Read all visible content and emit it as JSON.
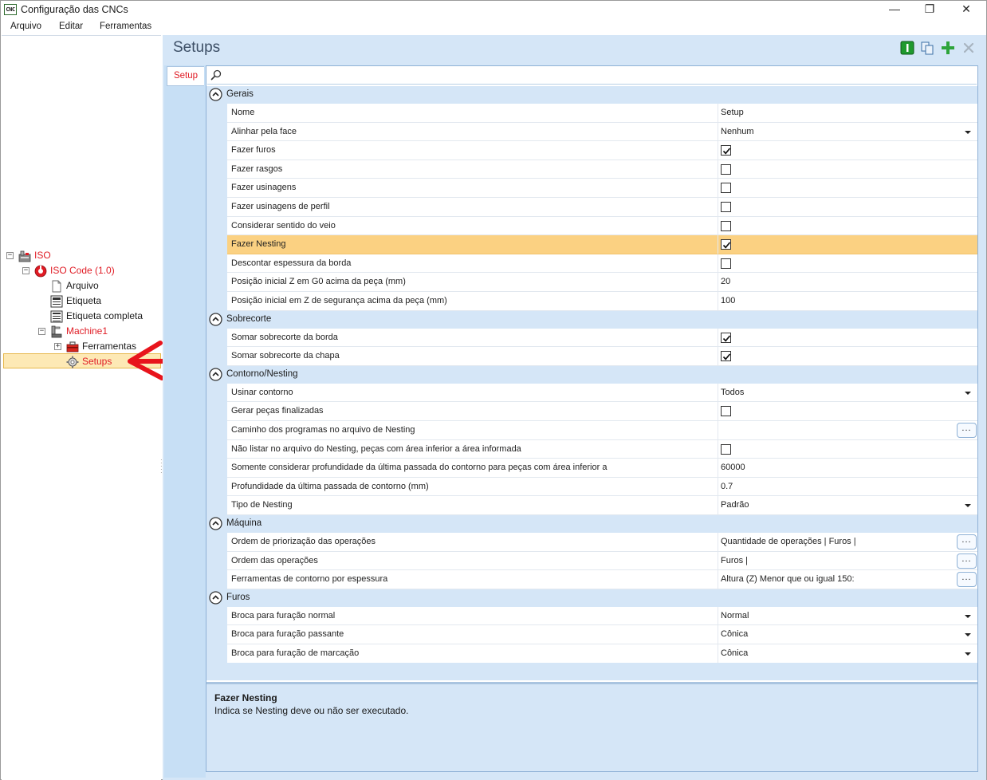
{
  "window": {
    "app_icon_text": "CNC",
    "title": "Configuração das CNCs",
    "minimize": "—",
    "maximize": "❐",
    "close": "✕"
  },
  "menu": {
    "items": [
      "Arquivo",
      "Editar",
      "Ferramentas"
    ]
  },
  "tree": {
    "items": [
      {
        "label": "ISO",
        "icon": "machine-folder-icon"
      },
      {
        "label": "ISO Code (1.0)",
        "icon": "iso-code-icon"
      },
      {
        "label": "Arquivo",
        "icon": "file-icon"
      },
      {
        "label": "Etiqueta",
        "icon": "label-icon"
      },
      {
        "label": "Etiqueta completa",
        "icon": "label-full-icon"
      },
      {
        "label": "Machine1",
        "icon": "machine-icon"
      },
      {
        "label": "Ferramentas",
        "icon": "toolbox-icon"
      },
      {
        "label": "Setups",
        "icon": "gear-icon"
      }
    ]
  },
  "main": {
    "title": "Setups",
    "tab": "Setup",
    "search": {
      "value": "",
      "placeholder": ""
    },
    "categories": [
      {
        "label": "Gerais",
        "rows": [
          {
            "name": "Nome",
            "type": "text",
            "value": "Setup"
          },
          {
            "name": "Alinhar pela face",
            "type": "dropdown",
            "value": "Nenhum"
          },
          {
            "name": "Fazer furos",
            "type": "checkbox",
            "checked": true
          },
          {
            "name": "Fazer rasgos",
            "type": "checkbox",
            "checked": false
          },
          {
            "name": "Fazer usinagens",
            "type": "checkbox",
            "checked": false
          },
          {
            "name": "Fazer usinagens de perfil",
            "type": "checkbox",
            "checked": false
          },
          {
            "name": "Considerar sentido do veio",
            "type": "checkbox",
            "checked": false
          },
          {
            "name": "Fazer Nesting",
            "type": "checkbox",
            "checked": true,
            "selected": true
          },
          {
            "name": "Descontar espessura da borda",
            "type": "checkbox",
            "checked": false
          },
          {
            "name": "Posição inicial Z em G0 acima da peça (mm)",
            "type": "text",
            "value": "20"
          },
          {
            "name": "Posição inicial em Z de segurança acima da peça (mm)",
            "type": "text",
            "value": "100"
          }
        ]
      },
      {
        "label": "Sobrecorte",
        "rows": [
          {
            "name": "Somar sobrecorte da borda",
            "type": "checkbox",
            "checked": true
          },
          {
            "name": "Somar sobrecorte da chapa",
            "type": "checkbox",
            "checked": true
          }
        ]
      },
      {
        "label": "Contorno/Nesting",
        "rows": [
          {
            "name": "Usinar contorno",
            "type": "dropdown",
            "value": "Todos"
          },
          {
            "name": "Gerar peças finalizadas",
            "type": "checkbox",
            "checked": false
          },
          {
            "name": "Caminho dos programas no arquivo de Nesting",
            "type": "ellipsis",
            "value": ""
          },
          {
            "name": "Não listar no arquivo do Nesting, peças com área inferior a área informada",
            "type": "checkbox",
            "checked": false
          },
          {
            "name": "Somente considerar profundidade da última passada do contorno para peças com área inferior a",
            "type": "text",
            "value": "60000"
          },
          {
            "name": "Profundidade da última passada de contorno (mm)",
            "type": "text",
            "value": "0.7"
          },
          {
            "name": "Tipo de Nesting",
            "type": "dropdown",
            "value": "Padrão"
          }
        ]
      },
      {
        "label": "Máquina",
        "rows": [
          {
            "name": "Ordem de priorização das operações",
            "type": "ellipsis",
            "value": "Quantidade de operações | Furos |"
          },
          {
            "name": "Ordem das operações",
            "type": "ellipsis",
            "value": "Furos |"
          },
          {
            "name": "Ferramentas de contorno por espessura",
            "type": "ellipsis",
            "value": "Altura (Z) Menor que ou igual 150:"
          }
        ]
      },
      {
        "label": "Furos",
        "rows": [
          {
            "name": "Broca para furação normal",
            "type": "dropdown",
            "value": "Normal"
          },
          {
            "name": "Broca para furação passante",
            "type": "dropdown",
            "value": "Cônica"
          },
          {
            "name": "Broca para furação de marcação",
            "type": "dropdown",
            "value": "Cônica"
          }
        ]
      }
    ],
    "ellipsis_label": "...",
    "description": {
      "title": "Fazer Nesting",
      "text": "Indica se Nesting deve ou não ser executado."
    }
  },
  "colors": {
    "accent_red": "#e01b24",
    "selection_orange": "#fbd182",
    "panel_blue": "#d5e6f7",
    "annotation_arrow": "#e8141c"
  }
}
